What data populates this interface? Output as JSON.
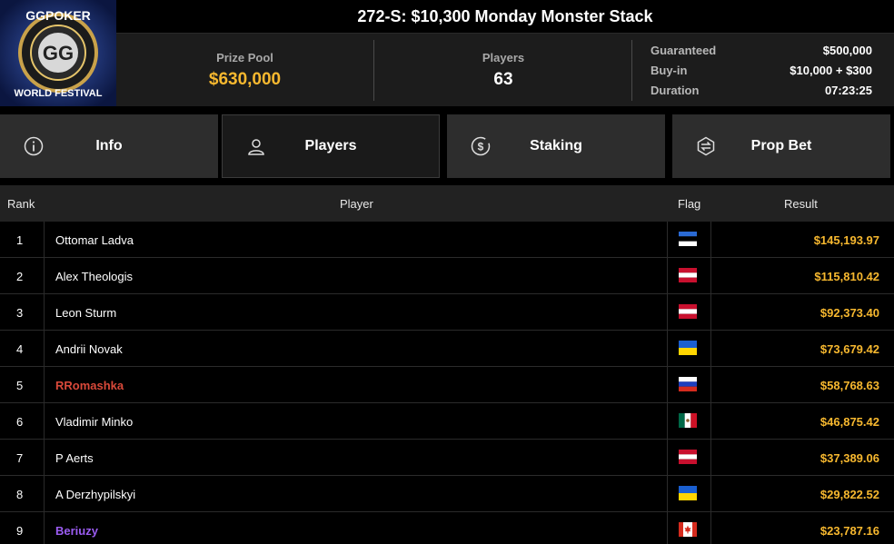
{
  "logo": {
    "top_text": "GGPOKER",
    "mark": "GG",
    "bottom_text": "WORLD FESTIVAL"
  },
  "tournament": {
    "title": "272-S: $10,300 Monday Monster Stack"
  },
  "stats": {
    "prize_pool_label": "Prize Pool",
    "prize_pool_value": "$630,000",
    "players_label": "Players",
    "players_value": "63"
  },
  "details": [
    {
      "label": "Guaranteed",
      "value": "$500,000"
    },
    {
      "label": "Buy-in",
      "value": "$10,000 + $300"
    },
    {
      "label": "Duration",
      "value": "07:23:25"
    }
  ],
  "tabs": [
    {
      "label": "Info",
      "icon": "info-icon",
      "active": false
    },
    {
      "label": "Players",
      "icon": "user-icon",
      "active": true
    },
    {
      "label": "Staking",
      "icon": "dollar-coin-icon",
      "active": false
    },
    {
      "label": "Prop Bet",
      "icon": "prop-bet-icon",
      "active": false
    }
  ],
  "table": {
    "headers": {
      "rank": "Rank",
      "player": "Player",
      "flag": "Flag",
      "result": "Result"
    },
    "rows": [
      {
        "rank": "1",
        "player": "Ottomar Ladva",
        "flag": "estonia-flag",
        "result": "$145,193.97",
        "style": "normal"
      },
      {
        "rank": "2",
        "player": "Alex Theologis",
        "flag": "austria-flag",
        "result": "$115,810.42",
        "style": "normal"
      },
      {
        "rank": "3",
        "player": "Leon Sturm",
        "flag": "austria-flag",
        "result": "$92,373.40",
        "style": "normal"
      },
      {
        "rank": "4",
        "player": "Andrii Novak",
        "flag": "ukraine-flag",
        "result": "$73,679.42",
        "style": "normal"
      },
      {
        "rank": "5",
        "player": "RRomashka",
        "flag": "russia-flag",
        "result": "$58,768.63",
        "style": "red"
      },
      {
        "rank": "6",
        "player": "Vladimir Minko",
        "flag": "mexico-flag",
        "result": "$46,875.42",
        "style": "normal"
      },
      {
        "rank": "7",
        "player": "P Aerts",
        "flag": "austria-flag",
        "result": "$37,389.06",
        "style": "normal"
      },
      {
        "rank": "8",
        "player": "A Derzhypilskyi",
        "flag": "ukraine-flag",
        "result": "$29,822.52",
        "style": "normal"
      },
      {
        "rank": "9",
        "player": "Beriuzy",
        "flag": "canada-flag",
        "result": "$23,787.16",
        "style": "purple"
      }
    ]
  },
  "colors": {
    "accent_gold": "#f7b82f",
    "highlight_red": "#d9493a",
    "highlight_purple": "#9b5cf2",
    "panel_bg": "#1c1c1c",
    "tab_bg": "#2d2d2d"
  }
}
